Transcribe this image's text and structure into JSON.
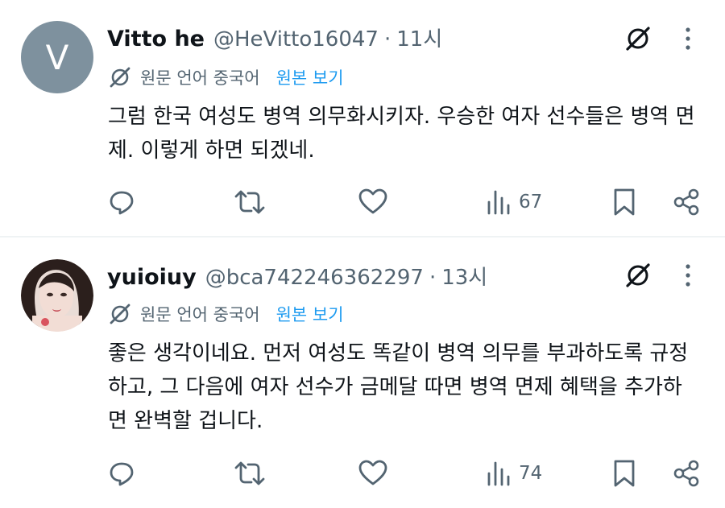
{
  "tweets": [
    {
      "avatar_letter": "V",
      "name": "Vitto he",
      "handle": "@HeVitto16047",
      "separator": "·",
      "time": "11시",
      "original_language": "원문 언어 중국어",
      "view_original": "원본 보기",
      "text": "그럼 한국 여성도 병역 의무화시키자. 우승한 여자 선수들은 병역 면제. 이렇게 하면 되겠네.",
      "views": "67"
    },
    {
      "name": "yuioiuy",
      "handle": "@bca742246362297",
      "separator": "·",
      "time": "13시",
      "original_language": "원문 언어 중국어",
      "view_original": "원본 보기",
      "text": "좋은 생각이네요. 먼저 여성도 똑같이 병역 의무를 부과하도록 규정하고, 그 다음에 여자 선수가 금메달 따면 병역 면제 혜택을 추가하면 완벽할 겁니다.",
      "views": "74"
    }
  ],
  "icons": [
    "grok-icon",
    "more-icon",
    "translate-icon",
    "reply-icon",
    "retweet-icon",
    "like-icon",
    "views-icon",
    "bookmark-icon",
    "share-icon"
  ],
  "colors": {
    "text": "#0f1419",
    "secondary": "#536471",
    "link": "#1d9bf0",
    "avatar_bg": "#7e919e",
    "divider": "#eff3f4"
  }
}
